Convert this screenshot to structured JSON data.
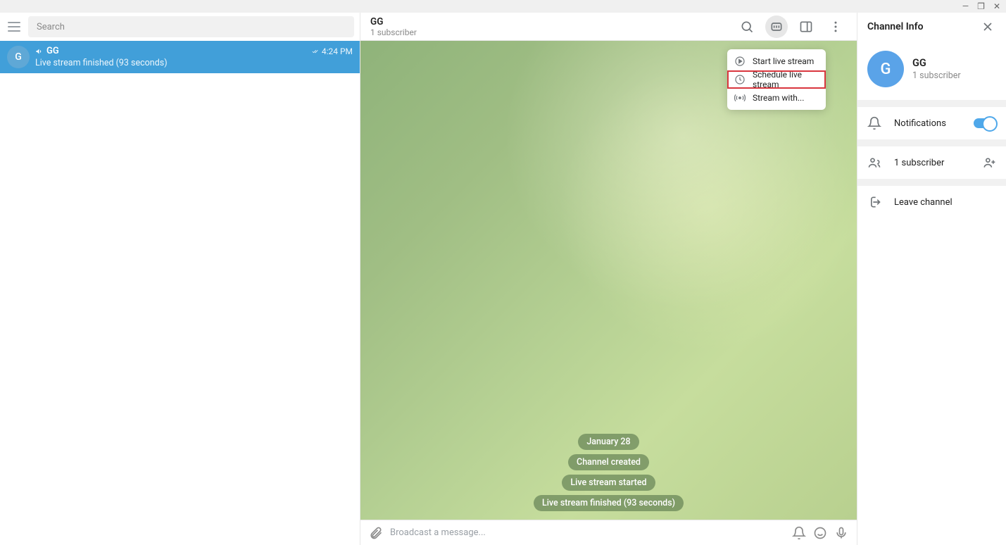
{
  "window_controls": {
    "minimize": "—",
    "maximize": "❐",
    "close": "✕"
  },
  "left": {
    "search_placeholder": "Search",
    "chat": {
      "avatar_letter": "G",
      "name": "GG",
      "time": "4:24 PM",
      "preview": "Live stream finished (93 seconds)"
    }
  },
  "header": {
    "title": "GG",
    "subtitle": "1 subscriber"
  },
  "dropdown": {
    "start": "Start live stream",
    "schedule": "Schedule live stream",
    "stream_with": "Stream with..."
  },
  "messages": {
    "date": "January 28",
    "created": "Channel created",
    "started": "Live stream started",
    "finished": "Live stream finished (93 seconds)"
  },
  "compose": {
    "placeholder": "Broadcast a message..."
  },
  "right": {
    "title": "Channel Info",
    "name": "GG",
    "avatar_letter": "G",
    "sub": "1 subscriber",
    "notifications": "Notifications",
    "subscribers": "1 subscriber",
    "leave": "Leave channel"
  }
}
